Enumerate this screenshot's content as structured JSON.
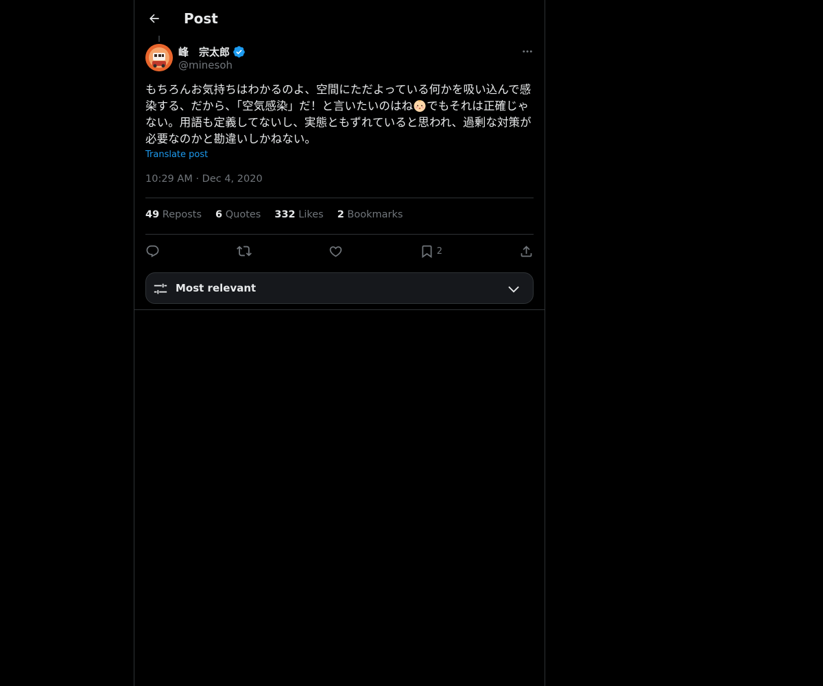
{
  "header": {
    "title": "Post"
  },
  "author": {
    "name": "峰　宗太郎",
    "handle": "@minesoh",
    "verified": true
  },
  "post": {
    "text_before_emoji": "もちろんお気持ちはわかるのよ、空間にただよっている何かを吸い込んで感染する、だから、「空気感染」だ！と言いたいのはね",
    "emoji": "baby-face-emoji",
    "text_after_emoji": "でもそれは正確じゃない。用語も定義してないし、実態ともずれていると思われ、過剰な対策が必要なのかと勘違いしかねない。",
    "translate_label": "Translate post",
    "time": "10:29 AM",
    "separator": "·",
    "date": "Dec 4, 2020"
  },
  "stats": [
    {
      "count": "49",
      "label": "Reposts"
    },
    {
      "count": "6",
      "label": "Quotes"
    },
    {
      "count": "332",
      "label": "Likes"
    },
    {
      "count": "2",
      "label": "Bookmarks"
    }
  ],
  "actions": {
    "reply_icon": "reply-icon",
    "repost_icon": "repost-icon",
    "like_icon": "heart-icon",
    "bookmark_icon": "bookmark-icon",
    "bookmark_count": "2",
    "share_icon": "share-icon"
  },
  "sort": {
    "label": "Most relevant"
  },
  "colors": {
    "background": "#000000",
    "text": "#e7e9ea",
    "muted": "#71767b",
    "accent": "#1d9bf0",
    "border": "#2f3336",
    "avatar": "#e8652c"
  }
}
